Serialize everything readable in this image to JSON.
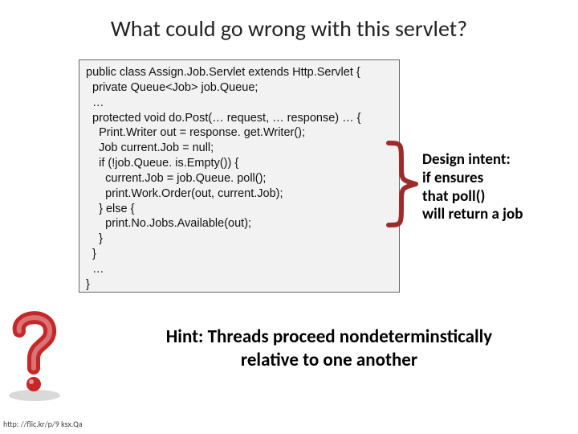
{
  "title": "What could go wrong with this servlet?",
  "code": "public class Assign.Job.Servlet extends Http.Servlet {\n  private Queue<Job> job.Queue;\n  …\n  protected void do.Post(… request, … response) … {\n    Print.Writer out = response. get.Writer();\n    Job current.Job = null;\n    if (!job.Queue. is.Empty()) {\n      current.Job = job.Queue. poll();\n      print.Work.Order(out, current.Job);\n    } else {\n      print.No.Jobs.Available(out);\n    }\n  }\n  …\n}",
  "annotation": {
    "label": "Design intent:",
    "line2": "if ensures",
    "line3_a": "that ",
    "line3_b": "poll()",
    "line4": "will return a job"
  },
  "hint": {
    "line1": "Hint: Threads proceed nondeterminstically",
    "line2": "relative to one another"
  },
  "credit": "http: //flic.kr/p/9 ksx.Qa",
  "icons": {
    "brace": "brace-icon",
    "question": "question-mark-icon"
  }
}
